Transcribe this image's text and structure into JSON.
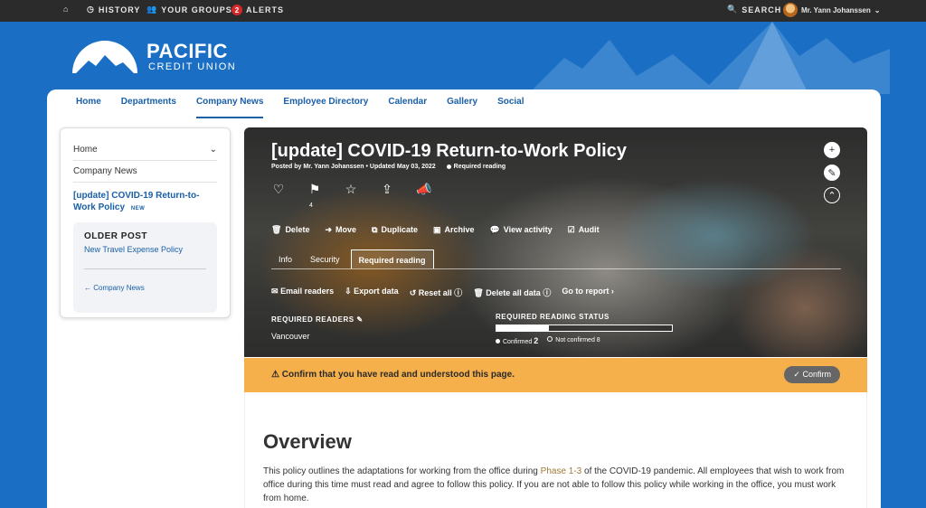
{
  "topbar": {
    "history": "HISTORY",
    "groups": "YOUR GROUPS",
    "alerts_count": "2",
    "alerts": "ALERTS",
    "search": "SEARCH",
    "user": "Mr. Yann Johanssen"
  },
  "logo": {
    "line1": "PACIFIC",
    "line2": "CREDIT UNION"
  },
  "nav": [
    "Home",
    "Departments",
    "Company News",
    "Employee Directory",
    "Calendar",
    "Gallery",
    "Social"
  ],
  "sidebar": {
    "home": "Home",
    "company_news": "Company News",
    "current": "[update] COVID-19 Return-to-Work Policy",
    "new_badge": "NEW",
    "older_heading": "OLDER POST",
    "older_link": "New Travel Expense Policy",
    "back_link": "Company News"
  },
  "article": {
    "title": "[update] COVID-19 Return-to-Work Policy",
    "posted_by": "Posted by Mr. Yann Johanssen",
    "updated": "Updated May 03, 2022",
    "required": "Required reading",
    "flag_count": "4",
    "actions": {
      "delete": "Delete",
      "move": "Move",
      "duplicate": "Duplicate",
      "archive": "Archive",
      "view_activity": "View activity",
      "audit": "Audit"
    },
    "tabs": {
      "info": "Info",
      "security": "Security",
      "required_reading": "Required reading"
    },
    "sub": {
      "email": "Email readers",
      "export": "Export data",
      "reset": "Reset all",
      "delete_all": "Delete all data",
      "report": "Go to report"
    },
    "readers_label": "REQUIRED READERS",
    "readers_value": "Vancouver",
    "status_label": "REQUIRED READING STATUS",
    "confirmed_label": "Confirmed",
    "confirmed_count": "2",
    "not_confirmed_label": "Not confirmed",
    "not_confirmed_count": "8",
    "confirmed_fraction": 0.3
  },
  "confirm": {
    "message": "Confirm that you have read and understood this page.",
    "button": "Confirm"
  },
  "content": {
    "heading": "Overview",
    "p_before": "This policy outlines the adaptations for working from the office during ",
    "p_link": "Phase 1-3",
    "p_after": " of the COVID-19 pandemic. All employees that wish to work from office during this time must read and agree to follow this policy. If you are not able to follow this policy while working in the office, you must work from home."
  }
}
